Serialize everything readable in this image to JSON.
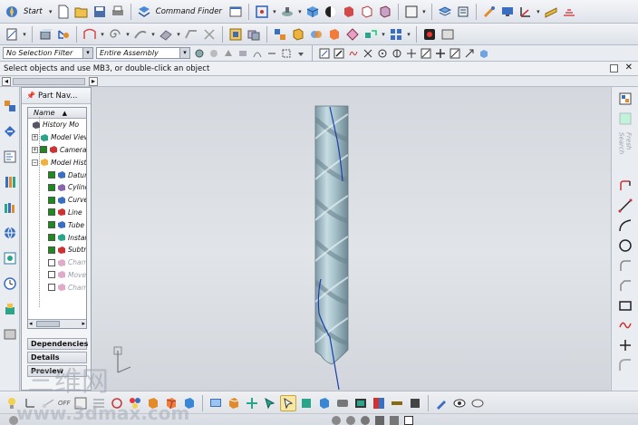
{
  "toolbar": {
    "start_label": "Start",
    "command_finder_label": "Command Finder"
  },
  "selection": {
    "filter_value": "No Selection Filter",
    "assembly_value": "Entire Assembly"
  },
  "status": {
    "text": "Select objects and use MB3, or double-click an object"
  },
  "part_navigator": {
    "title": "Part Nav...",
    "column_header": "Name",
    "sort_indicator": "▲",
    "items": [
      {
        "label": "History Mo",
        "level": 0
      },
      {
        "label": "Model Views",
        "level": 0,
        "expand": "+"
      },
      {
        "label": "Cameras",
        "level": 0,
        "expand": "+",
        "checked": true
      },
      {
        "label": "Model Hist",
        "level": 0,
        "expand": "−"
      },
      {
        "label": "Datum",
        "level": 1,
        "checked": true
      },
      {
        "label": "Cylinder",
        "level": 1,
        "checked": true
      },
      {
        "label": "Curve",
        "level": 1,
        "checked": true
      },
      {
        "label": "Line",
        "level": 1,
        "checked": true
      },
      {
        "label": "Tube",
        "level": 1,
        "checked": true
      },
      {
        "label": "Instance",
        "level": 1,
        "checked": true
      },
      {
        "label": "Subtract",
        "level": 1,
        "checked": true
      },
      {
        "label": "Chamfer",
        "level": 1,
        "checked": false,
        "dim": true
      },
      {
        "label": "Move",
        "level": 1,
        "checked": false,
        "dim": true
      },
      {
        "label": "Chamfer",
        "level": 1,
        "checked": false,
        "dim": true
      }
    ],
    "sections": [
      "Dependencies",
      "Details",
      "Preview"
    ]
  },
  "resource_bar": {
    "fresh_search_label": "Fresh Search"
  },
  "bottom": {
    "off_label": "OFF"
  },
  "watermark": {
    "chars": "三维网",
    "url": "www.3dmax.com"
  },
  "colors": {
    "viewport_bg": "#dde0e4",
    "model_steel": "#a9c2cc",
    "model_curve": "#1c3fae",
    "accent_blue": "#2b5fb5"
  }
}
